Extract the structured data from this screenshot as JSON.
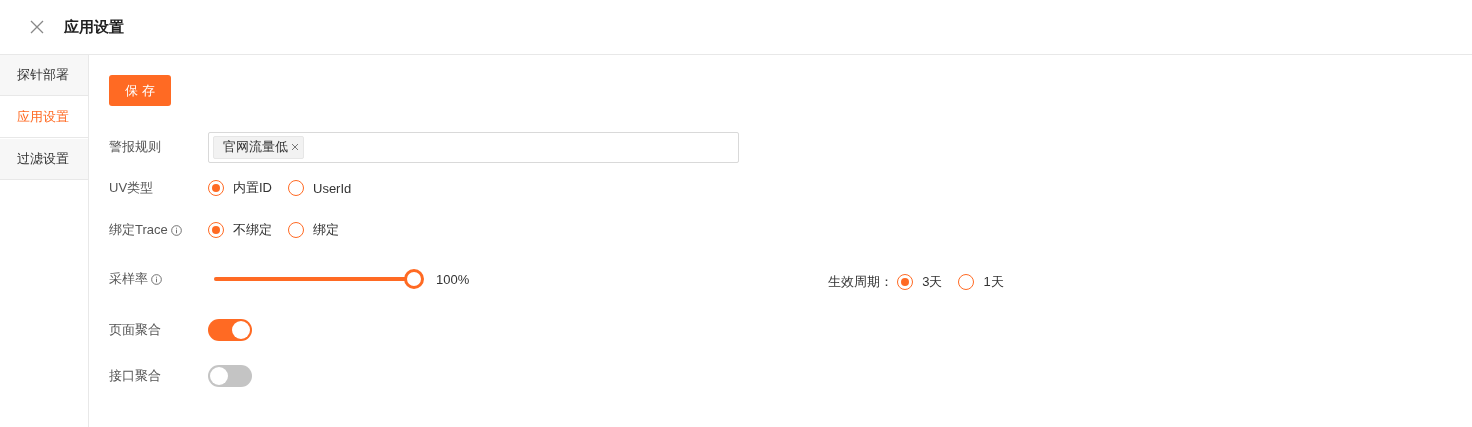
{
  "header": {
    "title": "应用设置"
  },
  "sidebar": {
    "items": [
      {
        "label": "探针部署",
        "selected": false
      },
      {
        "label": "应用设置",
        "selected": true
      },
      {
        "label": "过滤设置",
        "selected": false
      }
    ]
  },
  "save_button": "保 存",
  "form": {
    "rows": [
      {
        "kind": "tags",
        "label": "警报规则",
        "info": false,
        "tags": [
          "官网流量低"
        ]
      },
      {
        "kind": "radio",
        "label": "UV类型",
        "info": false,
        "options": [
          {
            "label": "内置ID",
            "selected": true
          },
          {
            "label": "UserId",
            "selected": false
          }
        ]
      },
      {
        "kind": "radio",
        "label": "绑定Trace",
        "info": true,
        "options": [
          {
            "label": "不绑定",
            "selected": true
          },
          {
            "label": "绑定",
            "selected": false
          }
        ]
      },
      {
        "kind": "slider",
        "label": "采样率",
        "info": true,
        "level": 1,
        "reading": "100%",
        "side": {
          "label": "生效周期：",
          "options": [
            {
              "label": "3天",
              "selected": true
            },
            {
              "label": "1天",
              "selected": false
            }
          ]
        }
      },
      {
        "kind": "switch",
        "label": "页面聚合",
        "info": false,
        "on": true
      },
      {
        "kind": "switch",
        "label": "接口聚合",
        "info": false,
        "on": false
      }
    ]
  }
}
